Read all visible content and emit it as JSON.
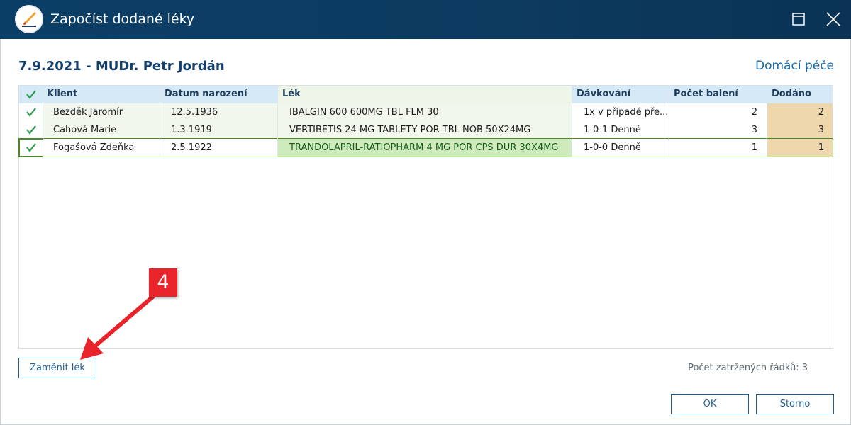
{
  "window": {
    "title": "Započíst dodané léky",
    "app_icon": "pencil-note-icon",
    "maximize_icon": "maximize-icon",
    "close_icon": "close-icon"
  },
  "header": {
    "title": "7.9.2021 - MUDr. Petr Jordán",
    "link": "Domácí péče"
  },
  "table": {
    "columns": [
      "Klient",
      "Datum narození",
      "Lék",
      "Dávkování",
      "Počet balení",
      "Dodáno"
    ],
    "check_icon": "checkmark-icon",
    "rows": [
      {
        "klient": "Bezděk Jaromír",
        "datum": "12.5.1936",
        "lek": "IBALGIN 600 600MG TBL FLM 30",
        "davkovani": "1x v případě pře...",
        "baleni": "2",
        "dodano": "2"
      },
      {
        "klient": "Cahová Marie",
        "datum": "1.3.1919",
        "lek": "VERTIBETIS 24 MG TABLETY POR TBL NOB 50X24MG",
        "davkovani": "1-0-1 Denně",
        "baleni": "3",
        "dodano": "3"
      },
      {
        "klient": "Fogašová Zdeňka",
        "datum": "2.5.1922",
        "lek": "TRANDOLAPRIL-RATIOPHARM 4 MG POR CPS DUR 30X4MG",
        "davkovani": "1-0-0 Denně",
        "baleni": "1",
        "dodano": "1"
      }
    ]
  },
  "buttons": {
    "replace": "Zaměnit lék",
    "ok": "OK",
    "cancel": "Storno"
  },
  "footer": {
    "count_text": "Počet zatržených řádků: 3"
  },
  "annotation": {
    "label": "4",
    "color": "#e8242a"
  },
  "colors": {
    "titlebar": "#0d3a5f",
    "accent": "#123f6b",
    "check_green": "#2a9a4a",
    "dodano_bg": "#eed7ad"
  }
}
